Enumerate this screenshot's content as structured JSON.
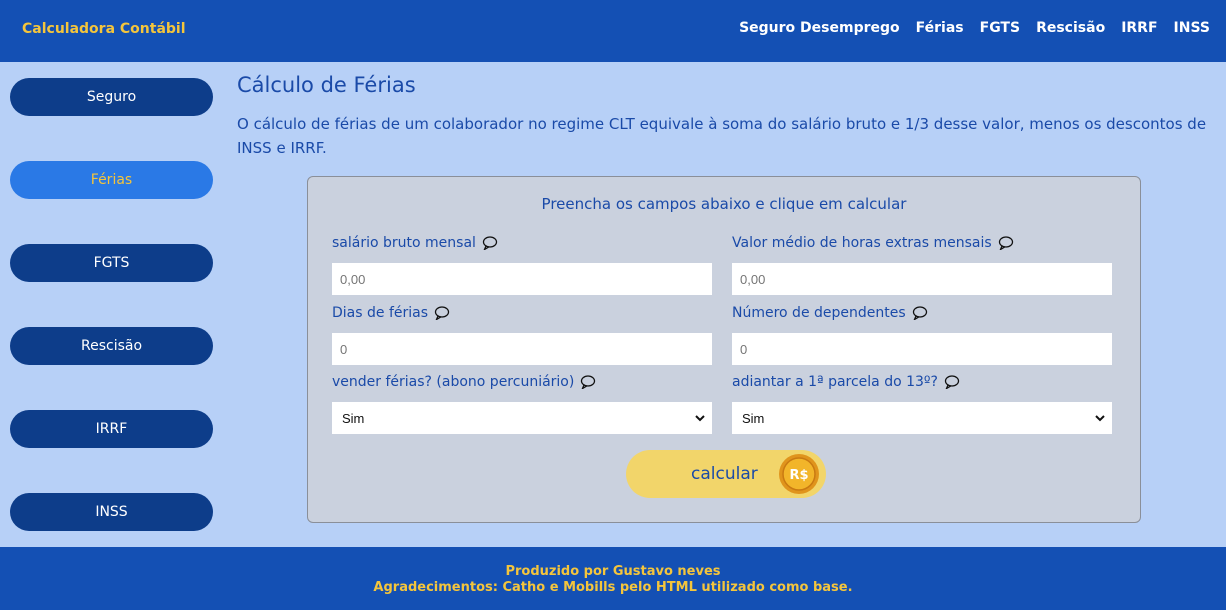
{
  "header": {
    "brand": "Calculadora Contábil",
    "nav": [
      "Seguro Desemprego",
      "Férias",
      "FGTS",
      "Rescisão",
      "IRRF",
      "INSS"
    ]
  },
  "sidebar": {
    "items": [
      {
        "label": "Seguro",
        "active": false
      },
      {
        "label": "Férias",
        "active": true
      },
      {
        "label": "FGTS",
        "active": false
      },
      {
        "label": "Rescisão",
        "active": false
      },
      {
        "label": "IRRF",
        "active": false
      },
      {
        "label": "INSS",
        "active": false
      }
    ]
  },
  "main": {
    "title": "Cálculo de Férias",
    "description": "O cálculo de férias de um colaborador no regime CLT equivale à soma do salário bruto e 1/3 desse valor, menos os descontos de INSS e IRRF."
  },
  "form": {
    "title": "Preencha os campos abaixo e clique em calcular",
    "salario": {
      "label": "salário bruto mensal",
      "placeholder": "0,00"
    },
    "horas_extras": {
      "label": "Valor médio de horas extras mensais",
      "placeholder": "0,00"
    },
    "dias": {
      "label": "Dias de férias",
      "placeholder": "0"
    },
    "dependentes": {
      "label": "Número de dependentes",
      "placeholder": "0"
    },
    "abono": {
      "label": "vender férias? (abono percuniário)",
      "value": "Sim"
    },
    "decimo": {
      "label": "adiantar a 1ª parcela do 13º?",
      "value": "Sim"
    },
    "calc_label": "calcular",
    "coin_text": "R$"
  },
  "footer": {
    "line1": "Produzido por Gustavo neves",
    "line2": "Agradecimentos: Catho e Mobills pelo HTML utilizado como base."
  },
  "colors": {
    "header_bg": "#1450b4",
    "page_bg": "#b7d0f7",
    "accent_yellow": "#f4c53c",
    "sidebar_btn": "#0d3d8a",
    "sidebar_active": "#2a79e6",
    "text_blue": "#1a4aa8",
    "calc_btn": "#f2d56a"
  },
  "icons": {
    "field_help": "speech-bubble-icon",
    "select_arrow": "chevron-down-icon",
    "coin": "coin-icon"
  }
}
